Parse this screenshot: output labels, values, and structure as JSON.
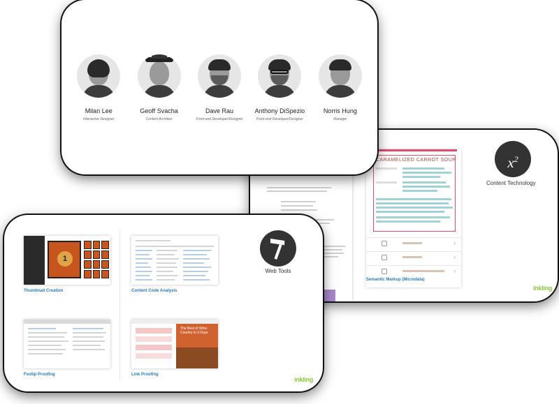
{
  "team": {
    "members": [
      {
        "name": "Milan Lee",
        "role": "Interactive Designer"
      },
      {
        "name": "Geoff Svacha",
        "role": "Content Architect"
      },
      {
        "name": "Dave Rau",
        "role": "Front-end Developer/Designer"
      },
      {
        "name": "Anthony DiSpezio",
        "role": "Front-end Developer/Designer"
      },
      {
        "name": "Norris Hung",
        "role": "Manager"
      }
    ]
  },
  "content_technology": {
    "icon_text": "x",
    "icon_sup": "2",
    "label": "Content Technology",
    "doc_title": "CARAMELIZED CARROT SOUP",
    "rows": [
      "",
      "",
      ""
    ],
    "caption": "Semantic Markup (Microdata)",
    "brand": "inkling"
  },
  "web_tools": {
    "label": "Web Tools",
    "icon": "hammer-icon"
  },
  "tools": {
    "thumbnail_big_number": "1",
    "items": [
      {
        "label": "Thumbnail Creation"
      },
      {
        "label": "Content Code Analysis"
      },
      {
        "label": "Footip Proofing"
      },
      {
        "label": "Link Proofing"
      }
    ],
    "link_proof_heading": "The Best of Wine Country in 3 Days",
    "brand": "inkling"
  },
  "colors": {
    "accent_blue": "#2b79b5",
    "brand_green": "#8cc63f",
    "thumbnail_orange": "#c6561d",
    "markup_pink": "#e04b6c"
  }
}
